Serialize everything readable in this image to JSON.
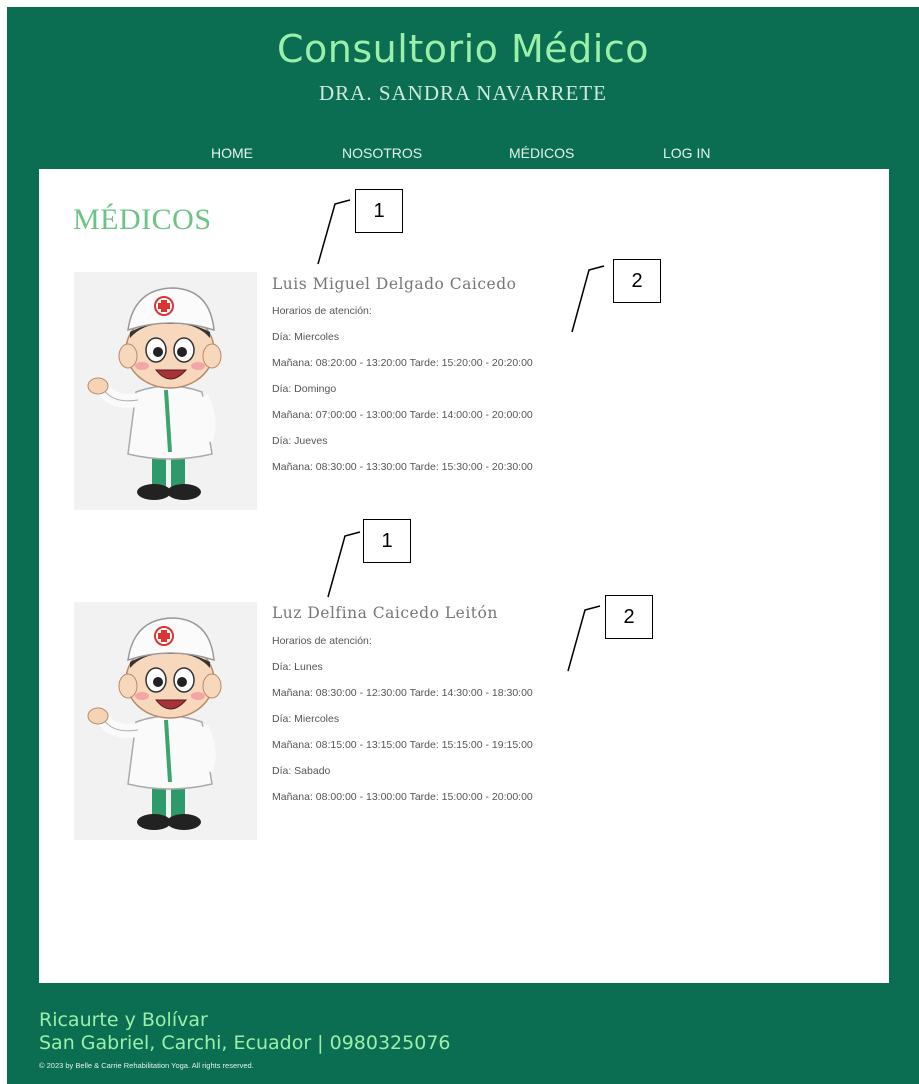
{
  "header": {
    "title": "Consultorio Médico",
    "subtitle": "DRA. SANDRA NAVARRETE"
  },
  "nav": {
    "items": [
      {
        "label": "HOME"
      },
      {
        "label": "NOSOTROS"
      },
      {
        "label": "MÉDICOS"
      },
      {
        "label": "LOG IN"
      }
    ]
  },
  "main": {
    "section_title": "MÉDICOS",
    "doctors": [
      {
        "name": "Luis Miguel Delgado Caicedo",
        "schedule_label": "Horarios de atención:",
        "days": [
          {
            "day": "Día: Miercoles",
            "hours": "Mañana: 08:20:00 - 13:20:00 Tarde: 15:20:00 - 20:20:00"
          },
          {
            "day": "Día: Domingo",
            "hours": "Mañana: 07:00:00 - 13:00:00 Tarde: 14:00:00 - 20:00:00"
          },
          {
            "day": "Día: Jueves",
            "hours": "Mañana: 08:30:00 - 13:30:00 Tarde: 15:30:00 - 20:30:00"
          }
        ]
      },
      {
        "name": "Luz Delfina Caicedo Leitón",
        "schedule_label": "Horarios de atención:",
        "days": [
          {
            "day": "Día: Lunes",
            "hours": "Mañana: 08:30:00 - 12:30:00 Tarde: 14:30:00 - 18:30:00"
          },
          {
            "day": "Día: Miercoles",
            "hours": "Mañana: 08:15:00 - 13:15:00 Tarde: 15:15:00 - 19:15:00"
          },
          {
            "day": "Día: Sabado",
            "hours": "Mañana: 08:00:00 - 13:00:00 Tarde: 15:00:00 - 20:00:00"
          }
        ]
      }
    ]
  },
  "annotations": {
    "callout_1": "1",
    "callout_2": "2"
  },
  "footer": {
    "address": "Ricaurte y Bolívar",
    "city_phone": "San Gabriel, Carchi, Ecuador | 0980325076",
    "copyright": "© 2023 by Belle & Carrie Rehabilitation Yoga. All rights reserved."
  },
  "colors": {
    "background": "#0b6e52",
    "title_green": "#9af0a8",
    "section_green": "#6cc384"
  },
  "icons": {
    "doctor_image": "cartoon-doctor-illustration"
  }
}
